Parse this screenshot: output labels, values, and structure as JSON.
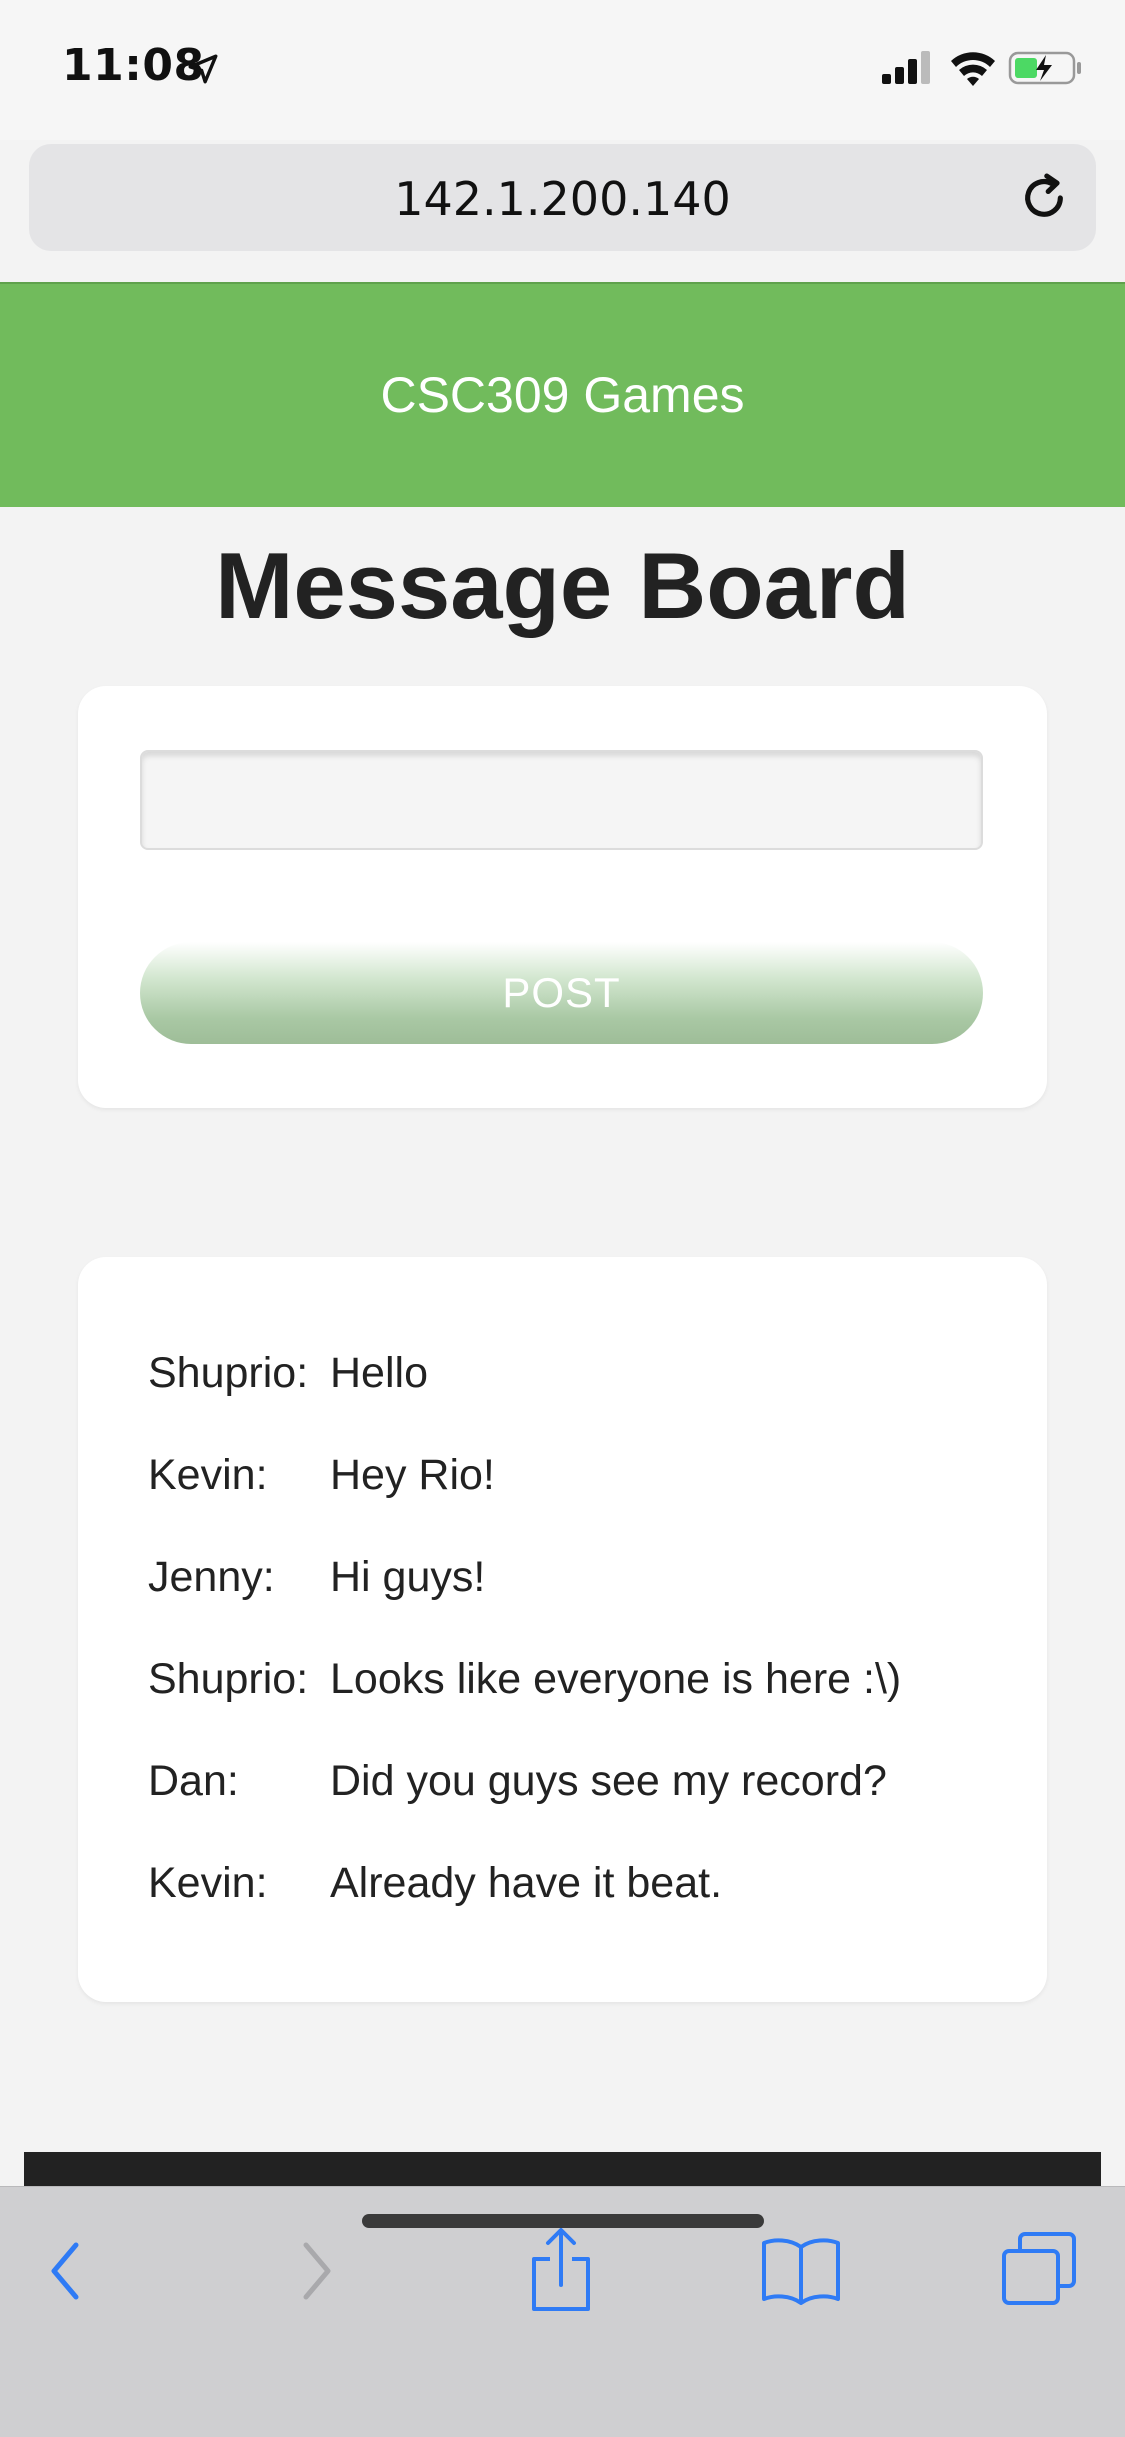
{
  "status_bar": {
    "time": "11:08",
    "icons": [
      "location-arrow-icon",
      "cellular-signal-icon",
      "wifi-icon",
      "battery-charging-icon"
    ]
  },
  "browser": {
    "url": "142.1.200.140",
    "reload_icon": "reload-icon"
  },
  "site": {
    "title": "CSC309 Games",
    "header_color": "#71bb5c"
  },
  "page": {
    "title": "Message Board"
  },
  "composer": {
    "input_value": "",
    "post_label": "POST"
  },
  "messages": [
    {
      "author": "Shuprio:",
      "text": "Hello"
    },
    {
      "author": "Kevin:",
      "text": "Hey Rio!"
    },
    {
      "author": "Jenny:",
      "text": "Hi guys!"
    },
    {
      "author": "Shuprio:",
      "text": "Looks like everyone is here :\\)"
    },
    {
      "author": "Dan:",
      "text": "Did you guys see my record?"
    },
    {
      "author": "Kevin:",
      "text": "Already have it beat."
    }
  ],
  "toolbar": {
    "icons": [
      "back-icon",
      "forward-icon",
      "share-icon",
      "bookmarks-icon",
      "tabs-icon"
    ],
    "accent_color": "#2f7bf5"
  }
}
